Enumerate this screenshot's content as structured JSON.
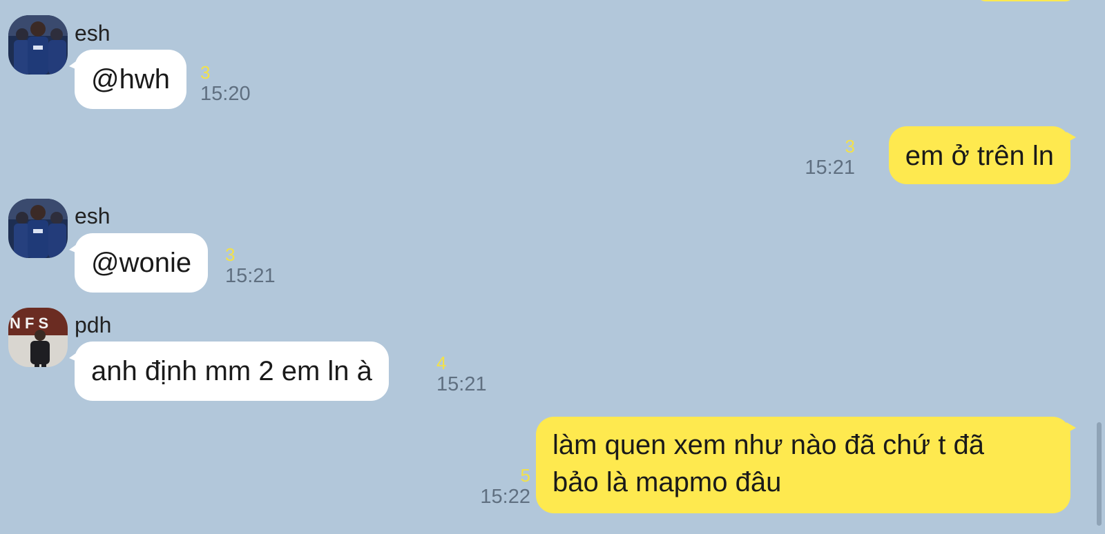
{
  "messages": [
    {
      "sender": "esh",
      "avatar_icon": "team-jersey-avatar",
      "direction": "incoming",
      "text": "@hwh",
      "unread": "3",
      "time": "15:20"
    },
    {
      "direction": "outgoing",
      "text": "em ở trên ln",
      "unread": "3",
      "time": "15:21"
    },
    {
      "sender": "esh",
      "avatar_icon": "team-jersey-avatar",
      "direction": "incoming",
      "text": "@wonie",
      "unread": "3",
      "time": "15:21"
    },
    {
      "sender": "pdh",
      "avatar_icon": "stage-person-avatar",
      "direction": "incoming",
      "text": "anh định mm 2 em ln à",
      "unread": "4",
      "time": "15:21"
    },
    {
      "direction": "outgoing",
      "text_line1": "làm quen xem như nào đã chứ t đã",
      "text_line2": "bảo là mapmo đâu",
      "unread": "5",
      "time": "15:22"
    }
  ],
  "colors": {
    "background": "#b2c7da",
    "incoming_bubble": "#ffffff",
    "outgoing_bubble": "#fee94f",
    "unread_count": "#f2e14a",
    "timestamp": "#5f6f80"
  }
}
